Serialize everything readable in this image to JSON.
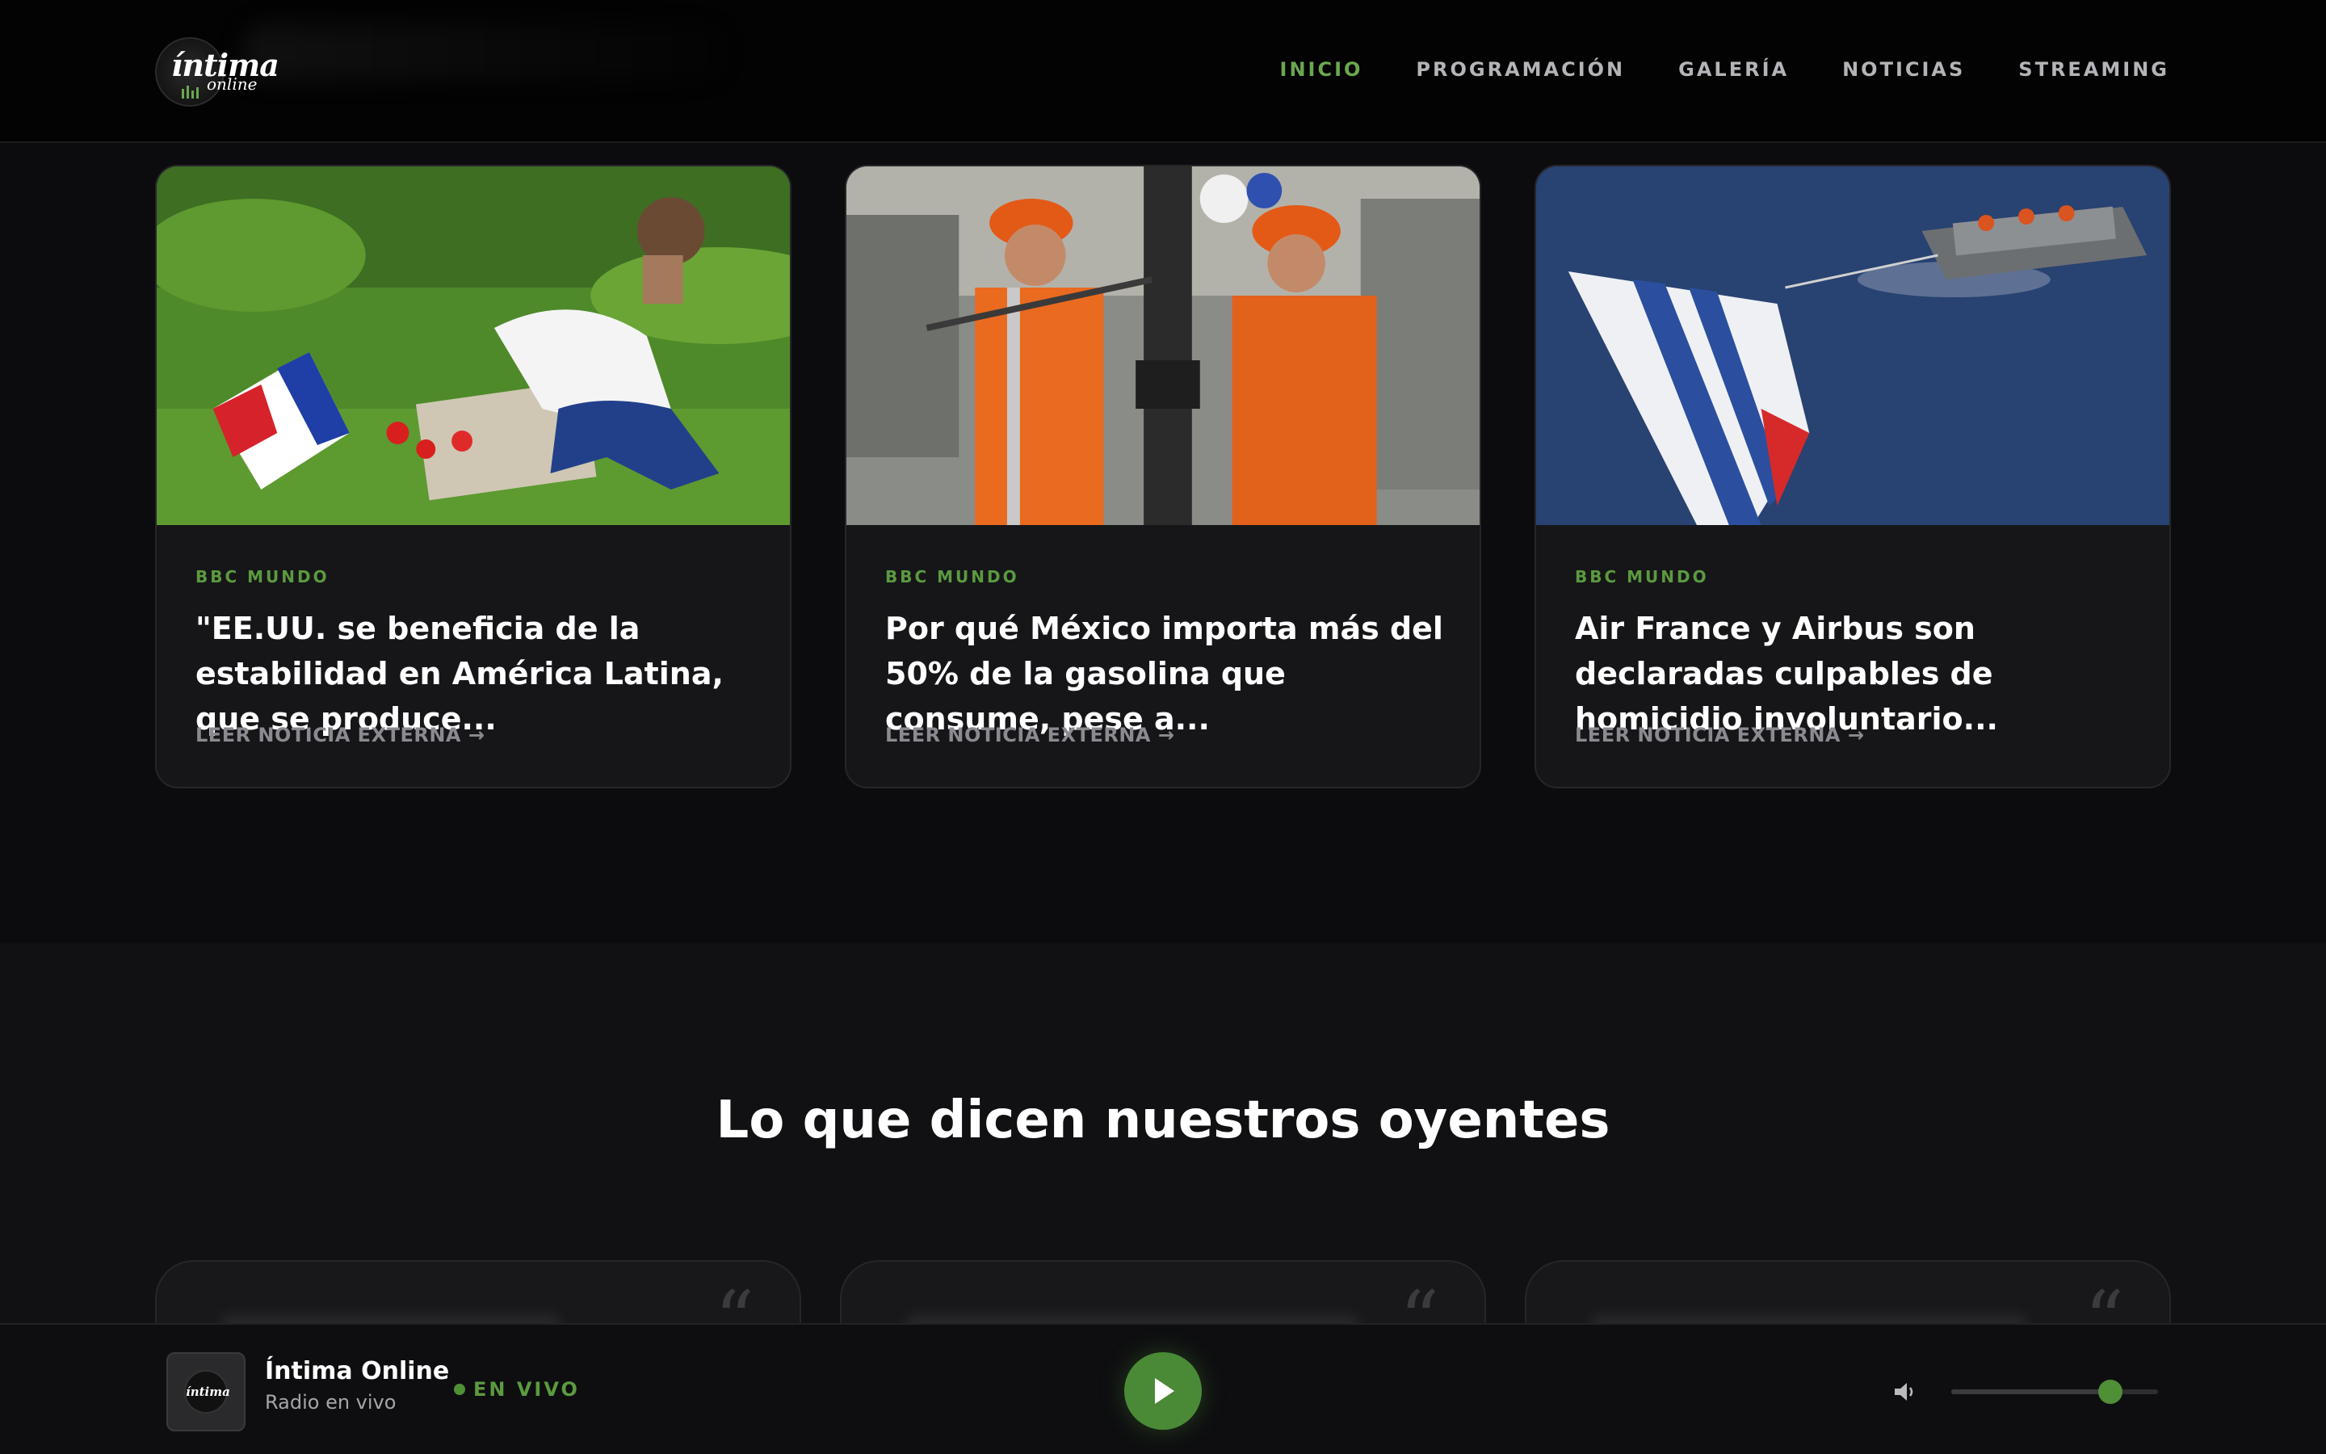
{
  "header": {
    "logo_text": "íntima",
    "logo_sub": "online",
    "nav": [
      {
        "label": "INICIO",
        "active": true
      },
      {
        "label": "PROGRAMACIÓN",
        "active": false
      },
      {
        "label": "GALERÍA",
        "active": false
      },
      {
        "label": "NOTICIAS",
        "active": false
      },
      {
        "label": "STREAMING",
        "active": false
      }
    ]
  },
  "news": [
    {
      "source": "BBC MUNDO",
      "title": "\"EE.UU. se beneficia de la estabilidad en América Latina, que se produce...",
      "link": "LEER NOTICIA EXTERNA →"
    },
    {
      "source": "BBC MUNDO",
      "title": "Por qué México importa más del 50% de la gasolina que consume, pese a...",
      "link": "LEER NOTICIA EXTERNA →"
    },
    {
      "source": "BBC MUNDO",
      "title": "Air France y Airbus son declaradas culpables de homicidio involuntario...",
      "link": "LEER NOTICIA EXTERNA →"
    }
  ],
  "testimonials": {
    "title": "Lo que dicen nuestros oyentes",
    "quote_glyph": "“"
  },
  "player": {
    "thumb_text": "íntima",
    "station": "Íntima Online",
    "subtitle": "Radio en vivo",
    "live_label": "EN VIVO",
    "volume": 0.77
  },
  "colors": {
    "accent": "#6aa84f",
    "background": "#0c0c0e",
    "card": "#161619"
  }
}
